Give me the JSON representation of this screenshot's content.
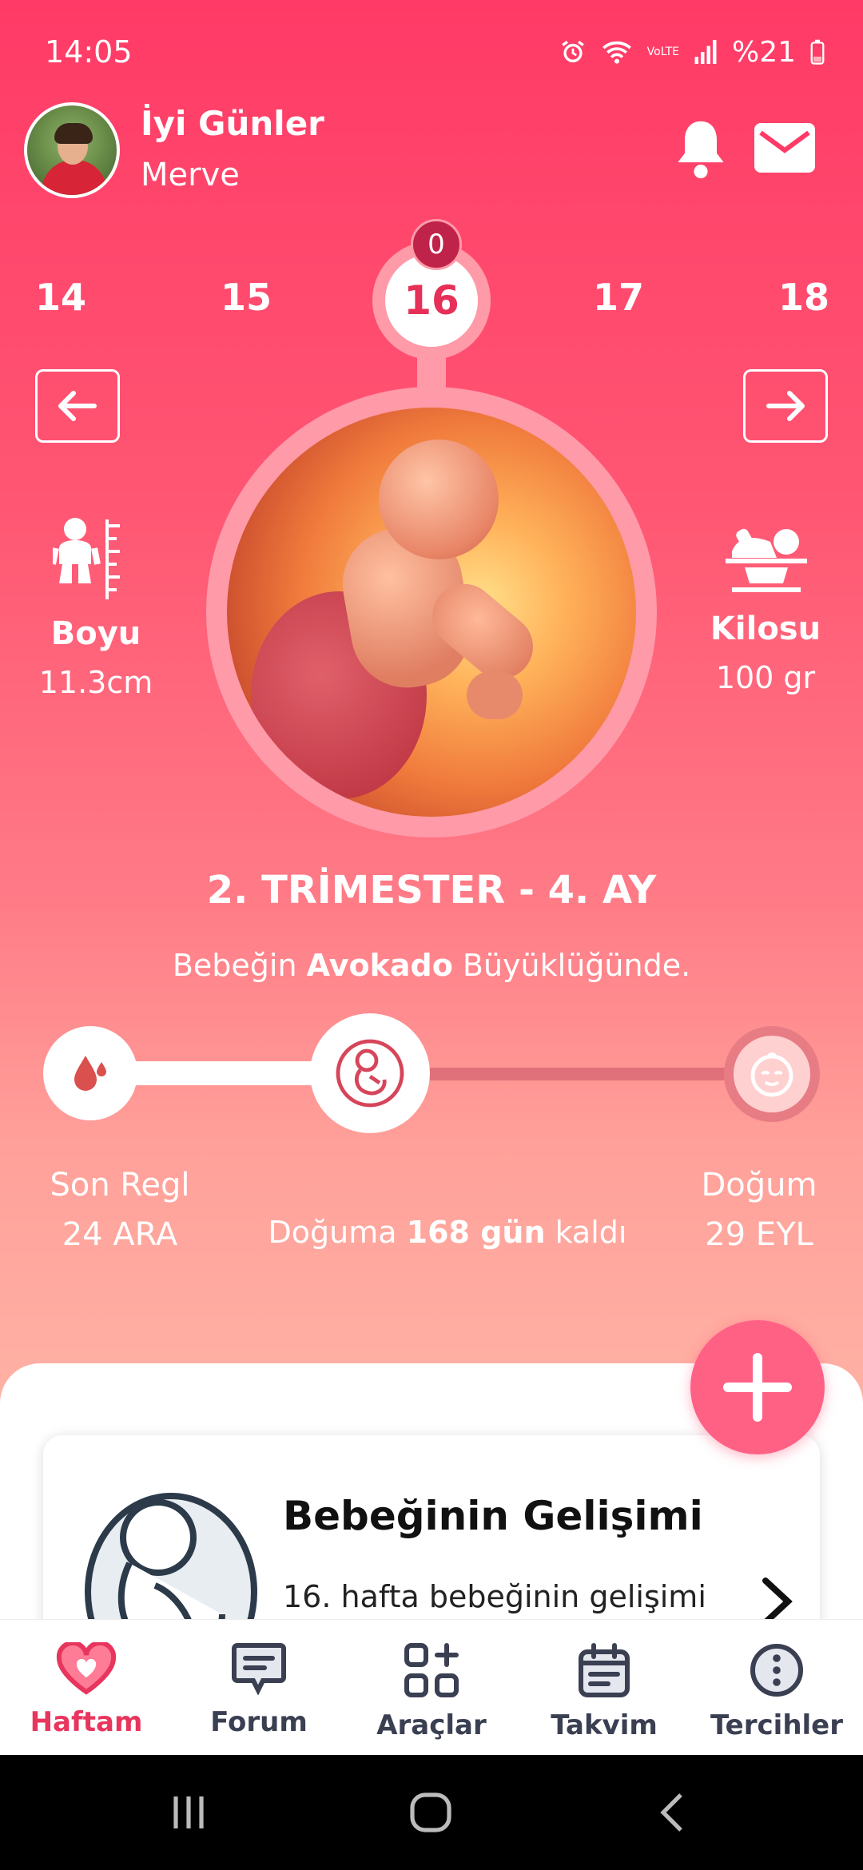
{
  "status": {
    "time": "14:05",
    "battery": "%21",
    "network": "VoLTE"
  },
  "header": {
    "greeting": "İyi Günler",
    "user": "Merve"
  },
  "weeks": {
    "items": [
      "14",
      "15",
      "16",
      "17",
      "18"
    ],
    "current": "16",
    "badge": "0"
  },
  "baby": {
    "length_label": "Boyu",
    "length_value": "11.3cm",
    "weight_label": "Kilosu",
    "weight_value": "100 gr"
  },
  "trimester": "2. TRİMESTER - 4. AY",
  "size": {
    "prefix": "Bebeğin",
    "fruit": "Avokado",
    "suffix": "Büyüklüğünde."
  },
  "progress": {
    "start_label": "Son Regl",
    "start_date": "24 ARA",
    "end_label": "Doğum",
    "end_date": "29 EYL",
    "remaining_prefix": "Doğuma",
    "remaining_value": "168 gün",
    "remaining_suffix": "kaldı"
  },
  "card": {
    "title": "Bebeğinin Gelişimi",
    "subtitle": "16. hafta bebeğinin gelişimi"
  },
  "nav": [
    {
      "label": "Haftam",
      "icon": "heart-icon",
      "active": true
    },
    {
      "label": "Forum",
      "icon": "chat-icon",
      "active": false
    },
    {
      "label": "Araçlar",
      "icon": "tools-grid-icon",
      "active": false
    },
    {
      "label": "Takvim",
      "icon": "calendar-icon",
      "active": false
    },
    {
      "label": "Tercihler",
      "icon": "more-dots-icon",
      "active": false
    }
  ],
  "colors": {
    "accent": "#e8355e",
    "hero_top": "#ff3a66",
    "hero_bottom": "#ffb3a6",
    "fab": "#ff6185"
  }
}
